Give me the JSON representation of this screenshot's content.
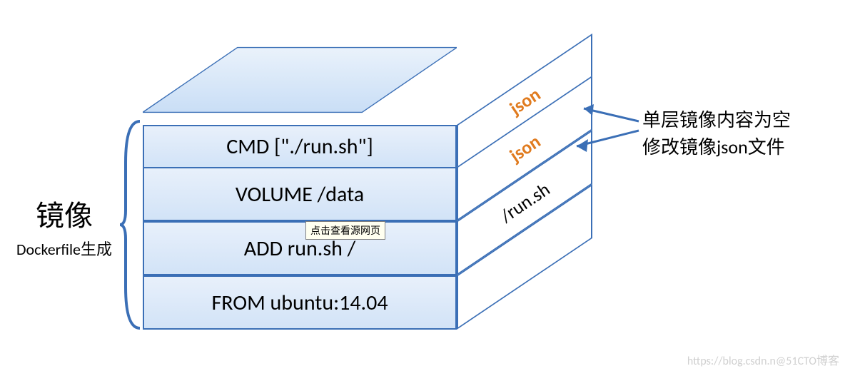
{
  "leftLabel": {
    "title": "镜像",
    "subtitle": "Dockerfile生成"
  },
  "layers": {
    "l3": "CMD [\"./run.sh\"]",
    "l2": "VOLUME /data",
    "l1": "ADD run.sh /",
    "l0": "FROM ubuntu:14.04"
  },
  "sides": {
    "s3": "json",
    "s2": "json",
    "s1": "/run.sh",
    "s0": ""
  },
  "rightNote": {
    "line1": "单层镜像内容为空",
    "line2": "修改镜像json文件"
  },
  "tooltip": "点击查看源网页",
  "watermark": "https://blog.csdn.n@51CTO博客",
  "chart_data": {
    "type": "diagram",
    "title": "Docker 镜像分层示意",
    "left_caption": {
      "main": "镜像",
      "sub": "Dockerfile生成"
    },
    "layers_bottom_to_top": [
      {
        "front": "FROM ubuntu:14.04",
        "side": ""
      },
      {
        "front": "ADD run.sh /",
        "side": "/run.sh"
      },
      {
        "front": "VOLUME /data",
        "side": "json"
      },
      {
        "front": "CMD [\"./run.sh\"]",
        "side": "json"
      }
    ],
    "right_annotation_applies_to_layers": [
      3,
      4
    ],
    "right_annotation": [
      "单层镜像内容为空",
      "修改镜像json文件"
    ]
  }
}
